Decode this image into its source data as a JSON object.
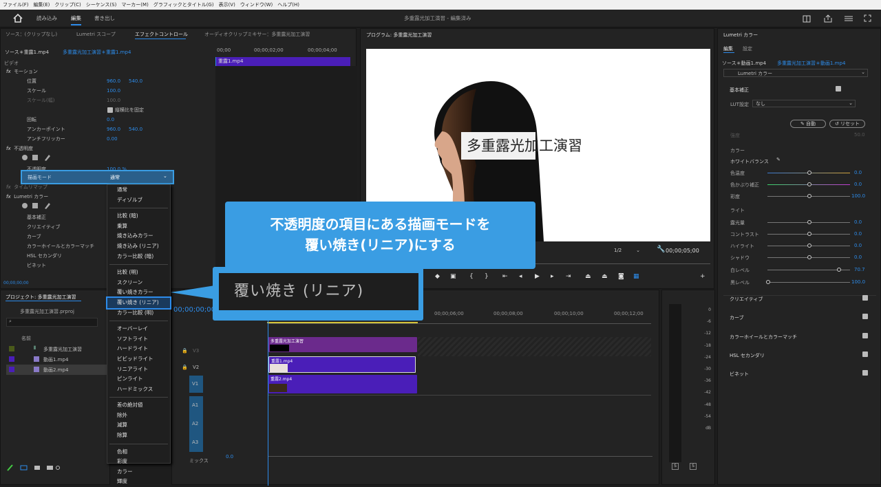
{
  "menu": [
    "ファイル(F)",
    "編集(E)",
    "クリップ(C)",
    "シーケンス(S)",
    "マーカー(M)",
    "グラフィックとタイトル(G)",
    "表示(V)",
    "ウィンドウ(W)",
    "ヘルプ(H)"
  ],
  "appbar": {
    "tabs": [
      "読み込み",
      "編集",
      "書き出し"
    ],
    "title": "多重露光加工演習 - 編集済み"
  },
  "source_tabs": [
    "ソース：(クリップなし)",
    "Lumetri スコープ",
    "エフェクトコントロール",
    "オーディオクリップミキサー：多重露光加工演習"
  ],
  "ec": {
    "source": "ソース＊重露1.mp4",
    "seq": "多重露光加工演習＊重露1.mp4",
    "ruler": [
      "00;00",
      "00;00;02;00",
      "00;00;04;00"
    ],
    "clip": "重露1.mp4",
    "video": "ビデオ",
    "rows": [
      "モーション",
      "位置",
      "スケール",
      "スケール(幅)",
      "縦横比を固定",
      "回転",
      "アンカーポイント",
      "アンチフリッカー",
      "不透明度",
      "不透明度",
      "描画モード",
      "タイムリマップ",
      "Lumetri カラー",
      "基本補正",
      "クリエイティブ",
      "カーブ",
      "カラーホイールとカラーマッチ",
      "HSL セカンダリ",
      "ビネット"
    ],
    "pos_x": "960.0",
    "pos_y": "540.0",
    "scale": "100.0",
    "scale_w": "100.0",
    "rot": "0.0",
    "anchor_x": "960.0",
    "anchor_y": "540.0",
    "flicker": "0.00",
    "opacity": "100.0 %",
    "blend": "通常",
    "time": "00;00;00;00"
  },
  "dropdown": [
    "通常",
    "ディゾルブ",
    "比較 (暗)",
    "乗算",
    "焼き込みカラー",
    "焼き込み (リニア)",
    "カラー比較 (暗)",
    "比較 (明)",
    "スクリーン",
    "覆い焼きカラー",
    "覆い焼き (リニア)",
    "カラー比較 (明)",
    "オーバーレイ",
    "ソフトライト",
    "ハードライト",
    "ビビッドライト",
    "リニアライト",
    "ピンライト",
    "ハードミックス",
    "差の絶対値",
    "除外",
    "減算",
    "除算",
    "色相",
    "彩度",
    "カラー",
    "輝度"
  ],
  "callout": {
    "line1": "不透明度の項目にある描画モードを",
    "line2": "覆い焼き(リニア)にする",
    "zoom": "覆い焼き (リニア)"
  },
  "program": {
    "label": "プログラム: 多重露光加工演習",
    "overlay": "多重露光加工演習",
    "fit": "1/2",
    "tc": "00;00;05;00"
  },
  "project": {
    "tab": "プロジェクト: 多重露光加工演習",
    "file": "多重露光加工演習.prproj",
    "name_col": "名前",
    "items": [
      "多重露光加工演習",
      "動画1.mp4",
      "動画2.mp4"
    ],
    "search": ""
  },
  "timeline": {
    "tc": "00;00;00;00",
    "ruler": [
      "00;00;06;00",
      "00;00;08;00",
      "00;00;10;00",
      "00;00;12;00"
    ],
    "tracks": [
      "V3",
      "V2",
      "V1",
      "A1",
      "A2",
      "A3",
      "ミックス"
    ],
    "clips": [
      "多重露光加工演習",
      "重露1.mp4",
      "重露2.mp4"
    ],
    "mix": "0.0"
  },
  "meter": [
    "0",
    "-6",
    "-12",
    "-18",
    "-24",
    "-30",
    "-36",
    "-42",
    "-48",
    "-54",
    "dB"
  ],
  "lumetri": {
    "title": "Lumetri カラー",
    "tabs": [
      "編集",
      "設定"
    ],
    "source": "ソース＊動画1.mp4",
    "seq": "多重露光加工演習＊動画1.mp4",
    "fx": "Lumetri カラー",
    "basic": "基本補正",
    "lut": "LUT設定",
    "lut_val": "なし",
    "auto": "自動",
    "reset": "リセット",
    "intensity": "強度",
    "intensity_val": "50.0",
    "color": "カラー",
    "wb": "ホワイトバランス",
    "temp": "色温度",
    "tint": "色かぶり補正",
    "sat": "彩度",
    "light": "ライト",
    "exposure": "露光量",
    "contrast": "コントラスト",
    "highlight": "ハイライト",
    "shadow": "シャドウ",
    "white": "白レベル",
    "black": "黒レベル",
    "vals": {
      "temp": "0.0",
      "tint": "0.0",
      "sat": "100.0",
      "exposure": "0.0",
      "contrast": "0.0",
      "highlight": "0.0",
      "shadow": "0.0",
      "white": "70.7",
      "black": "100.0"
    },
    "sections": [
      "クリエイティブ",
      "カーブ",
      "カラーホイールとカラーマッチ",
      "HSL セカンダリ",
      "ビネット"
    ]
  },
  "colors": {
    "accent": "#2d8ceb",
    "callout": "#3a9de3",
    "purple": "#6b2a8c",
    "violet": "#4a1eb8"
  }
}
